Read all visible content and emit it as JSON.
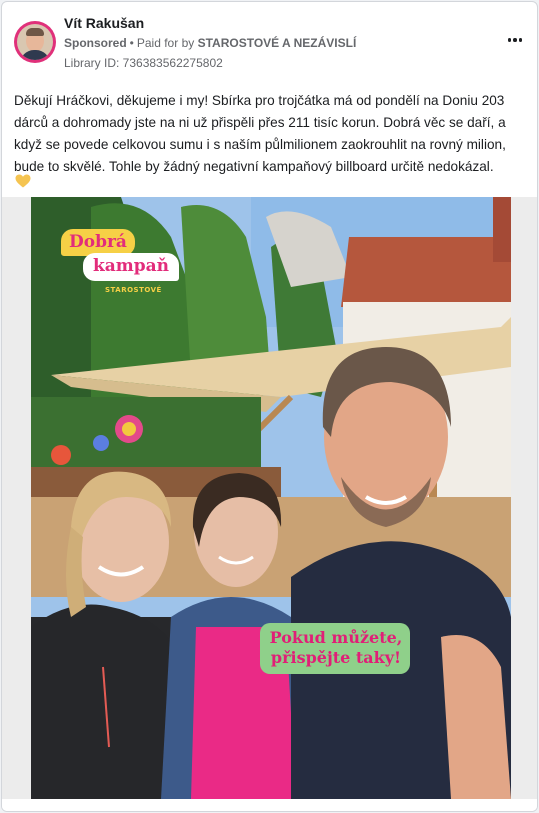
{
  "post": {
    "author": "Vít Rakušan",
    "sponsored_label": "Sponsored",
    "paid_for_prefix": "Paid for by",
    "paid_for_by": "STAROSTOVÉ A NEZÁVISLÍ",
    "library_id": "Library ID: 736383562275802",
    "text": "Děkují Hráčkovi, děkujeme i my! Sbírka pro trojčátka má od pondělí na Doniu 203 dárců a dohromady jste na ni už přispěli přes 211 tisíc korun. Dobrá věc se daří, a když se povede celkovou sumu i s naším půlmilionem zaokrouhlit na rovný milion, bude to skvělé. Tohle by žádný negativní kampaňový billboard určitě nedokázal.",
    "emoji_icon": "yellow-heart-icon"
  },
  "image": {
    "badge_line1": "Dobrá",
    "badge_line2": "kampaň",
    "badge_brand": "STAROSTOVÉ",
    "cta_text": "Pokud můžete, přispějte taky!"
  },
  "colors": {
    "brand_pink": "#e22c7b",
    "brand_yellow": "#f6d046",
    "cta_green": "#8fd08a",
    "meta_gray": "#65676b"
  }
}
